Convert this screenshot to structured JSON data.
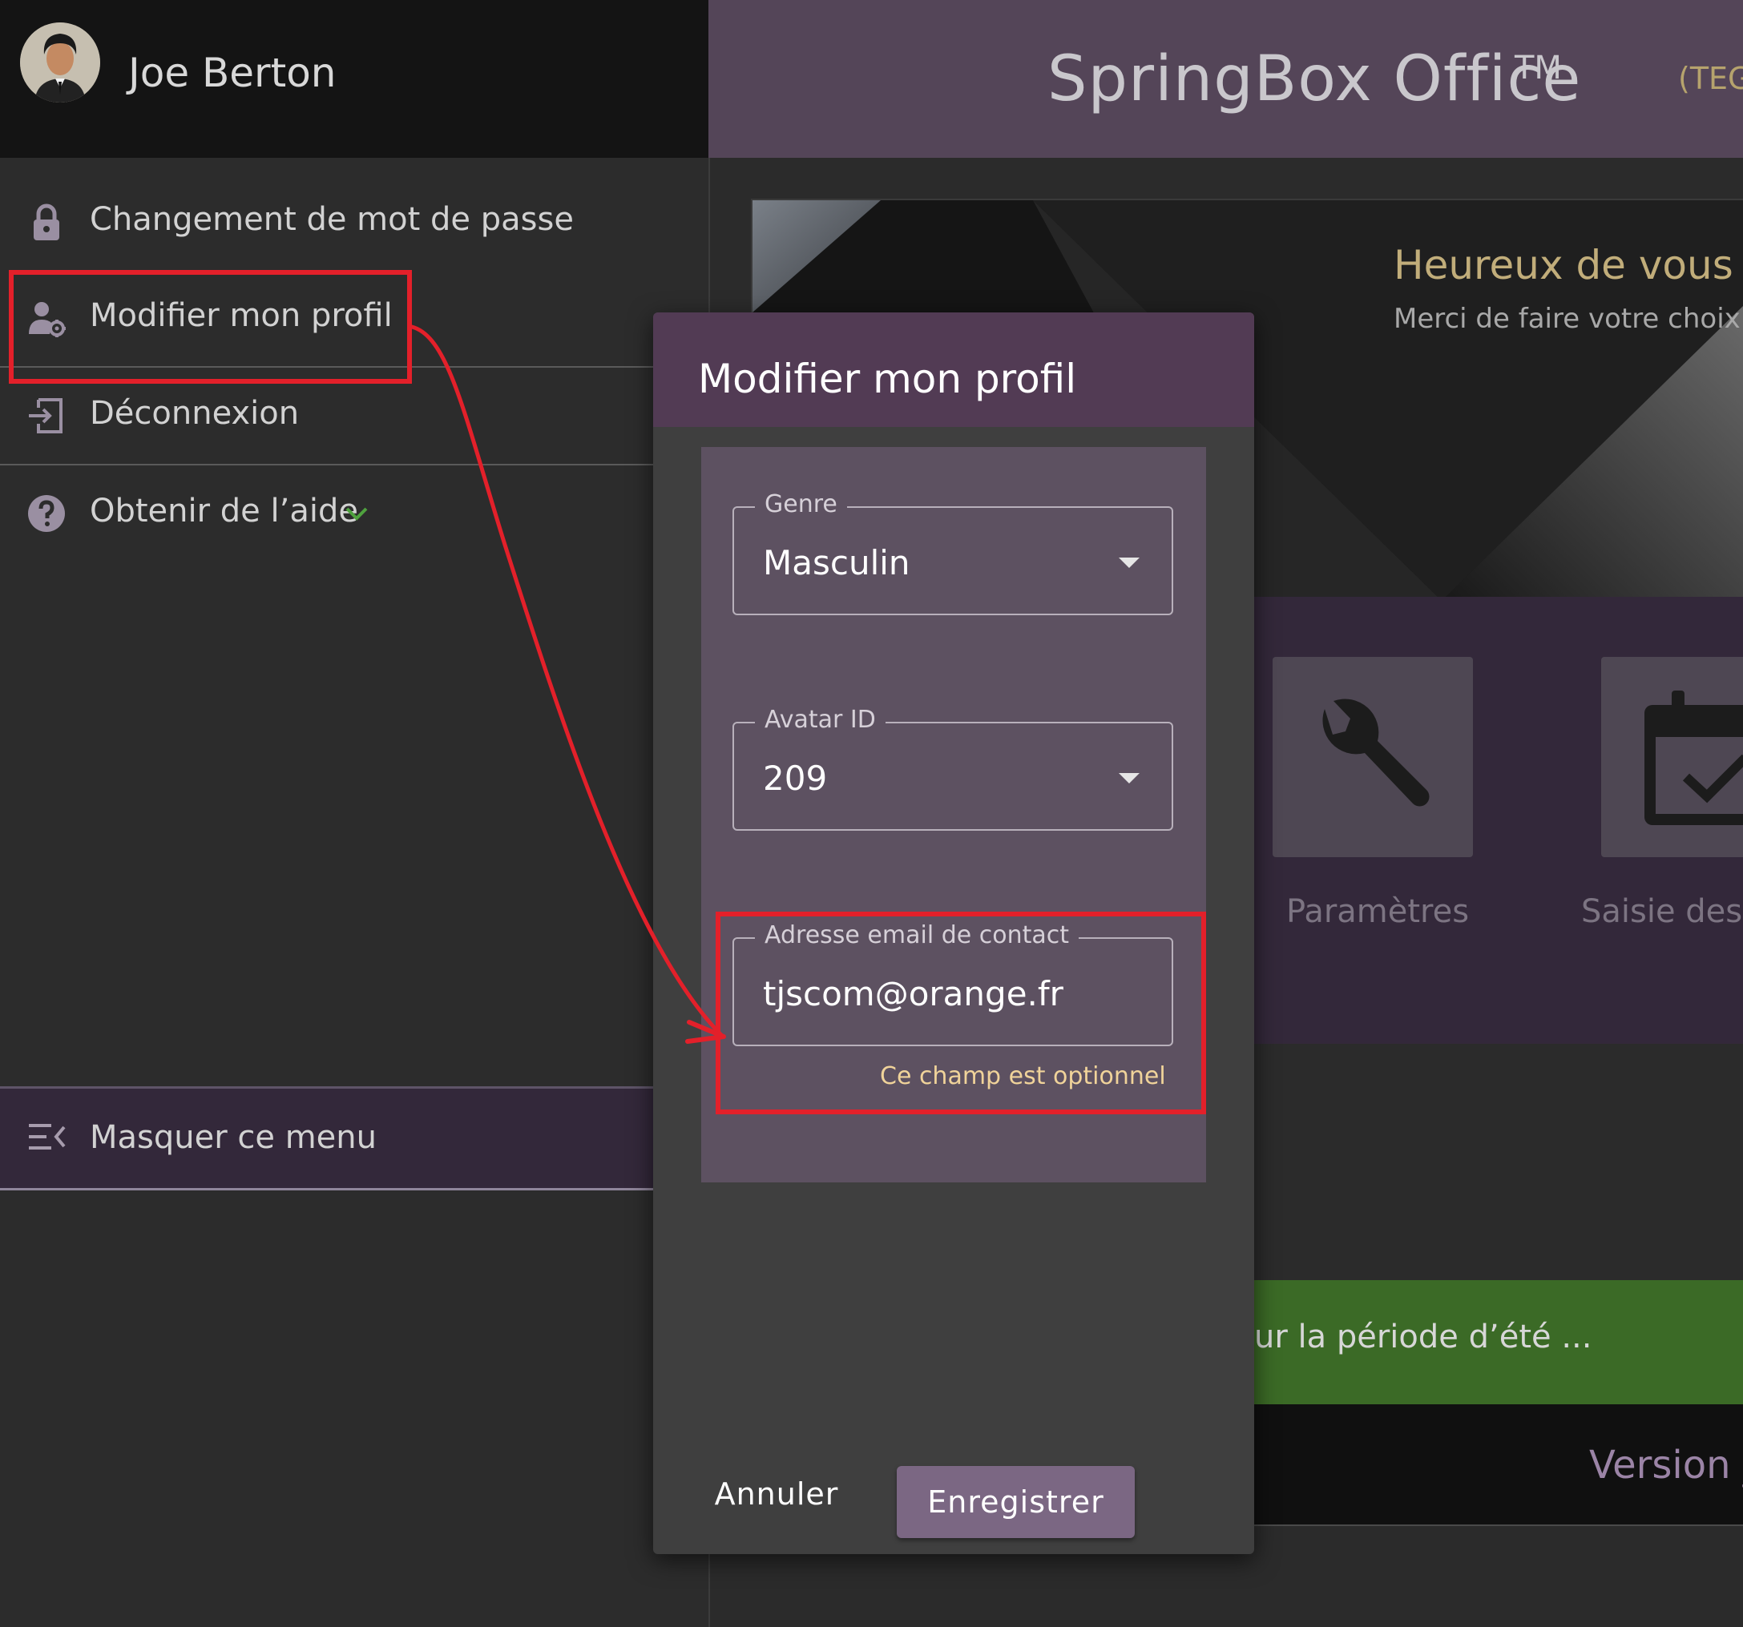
{
  "user": {
    "name": "Joe Berton"
  },
  "sidebar": {
    "items": [
      {
        "label": "Changement de mot de passe",
        "icon": "lock-icon"
      },
      {
        "label": "Modifier mon profil",
        "icon": "user-gear-icon"
      },
      {
        "label": "Déconnexion",
        "icon": "logout-icon"
      },
      {
        "label": "Obtenir de l’aide",
        "icon": "help-icon"
      }
    ],
    "hide_menu_label": "Masquer ce menu"
  },
  "appbar": {
    "title": "SpringBox Office",
    "trademark": "TM",
    "env": "(TEG"
  },
  "main": {
    "hero_title": "Heureux de vous re",
    "hero_subtitle": "Merci de faire votre choix p",
    "tiles": [
      {
        "label": "Paramètres",
        "icon": "wrench-icon"
      },
      {
        "label": "Saisie des t",
        "icon": "calendar-check-icon"
      }
    ],
    "announcement": "ur la période d’été ...",
    "version": "Version _"
  },
  "modal": {
    "title": "Modifier mon profil",
    "fields": {
      "gender": {
        "label": "Genre",
        "value": "Masculin"
      },
      "avatar": {
        "label": "Avatar ID",
        "value": "209"
      },
      "email": {
        "label": "Adresse email de contact",
        "value": "tjscom@orange.fr",
        "hint": "Ce champ est optionnel"
      }
    },
    "cancel_label": "Annuler",
    "save_label": "Enregistrer"
  },
  "colors": {
    "accent": "#523b54",
    "highlight": "#e3202a",
    "hint": "#f0d39a"
  }
}
